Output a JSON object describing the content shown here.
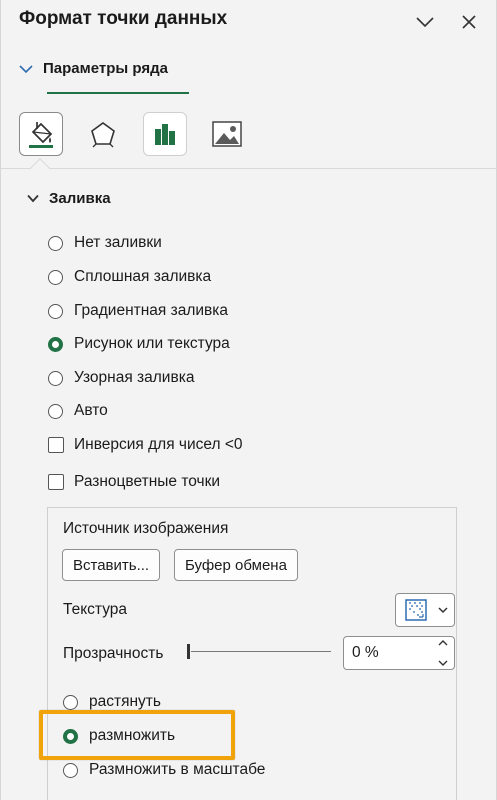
{
  "header": {
    "title": "Формат точки данных",
    "collapse_icon": "chevron-down-icon",
    "close_icon": "close-icon"
  },
  "section_tab": {
    "label": "Параметры ряда"
  },
  "category_icons": [
    {
      "name": "fill-line-icon",
      "active": true
    },
    {
      "name": "effects-pentagon-icon",
      "active": false
    },
    {
      "name": "series-options-bars-icon",
      "active": false
    },
    {
      "name": "picture-icon",
      "active": false
    }
  ],
  "fill_group": {
    "label": "Заливка",
    "options": [
      {
        "label": "Нет заливки",
        "checked": false
      },
      {
        "label": "Сплошная заливка",
        "checked": false
      },
      {
        "label": "Градиентная заливка",
        "checked": false
      },
      {
        "label": "Рисунок или текстура",
        "checked": true
      },
      {
        "label": "Узорная заливка",
        "checked": false
      },
      {
        "label": "Авто",
        "checked": false
      }
    ],
    "checkboxes": [
      {
        "label": "Инверсия для чисел <0",
        "checked": false
      },
      {
        "label": "Разноцветные точки",
        "checked": false
      }
    ]
  },
  "picture_source": {
    "label": "Источник изображения",
    "insert_label": "Вставить...",
    "clipboard_label": "Буфер обмена"
  },
  "texture": {
    "label": "Текстура"
  },
  "transparency": {
    "label": "Прозрачность",
    "value": "0 %",
    "level": 0
  },
  "tiling": {
    "options": [
      {
        "label": "растянуть",
        "checked": false
      },
      {
        "label": "размножить",
        "checked": true
      },
      {
        "label": "Размножить в масштабе",
        "checked": false
      }
    ]
  },
  "colors": {
    "accent": "#217346",
    "highlight": "#f0a30a"
  }
}
